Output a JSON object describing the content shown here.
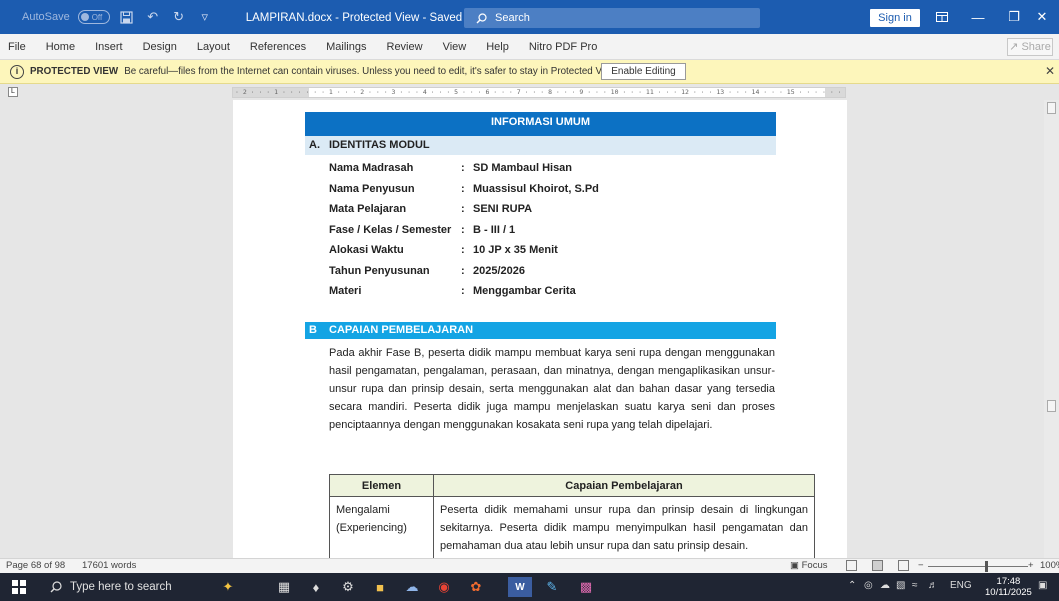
{
  "titlebar": {
    "autosave_label": "AutoSave",
    "autosave_state": "Off",
    "doc_title": "LAMPIRAN.docx  -  Protected View  -  Saved to this PC  ▾",
    "search_placeholder": "Search",
    "sign_in": "Sign in"
  },
  "menu": {
    "items": [
      "File",
      "Home",
      "Insert",
      "Design",
      "Layout",
      "References",
      "Mailings",
      "Review",
      "View",
      "Help",
      "Nitro PDF Pro"
    ],
    "share": "Share"
  },
  "protected_view": {
    "title": "PROTECTED VIEW",
    "message": "Be careful—files from the Internet can contain viruses. Unless you need to edit, it's safer to stay in Protected View.",
    "enable_button": "Enable Editing"
  },
  "ruler": {
    "text": "· 2 · · · 1 · · · · · · 1 · · · 2 · · · 3 · · · 4 · · · 5 · · · 6 · · · 7 · · · 8 · · · 9 · · · 10 · · · 11 · · · 12 · · · 13 · · · 14 · · · 15 · · · · · · 17 · · · 18 ·"
  },
  "document": {
    "header": "INFORMASI UMUM",
    "section_a": {
      "letter": "A.",
      "title": "IDENTITAS MODUL"
    },
    "fields": [
      {
        "label": "Nama Madrasah",
        "value": "SD Mambaul Hisan"
      },
      {
        "label": "Nama Penyusun",
        "value": "Muassisul Khoirot, S.Pd"
      },
      {
        "label": "Mata Pelajaran",
        "value": "SENI RUPA"
      },
      {
        "label": "Fase / Kelas / Semester",
        "value": "B - III / 1"
      },
      {
        "label": "Alokasi Waktu",
        "value": "10 JP x 35 Menit"
      },
      {
        "label": "Tahun Penyusunan",
        "value": "2025/2026"
      },
      {
        "label": "Materi",
        "value": "Menggambar Cerita"
      }
    ],
    "colon": ":",
    "section_b": {
      "letter": "B",
      "title": "CAPAIAN PEMBELAJARAN"
    },
    "paragraph": "Pada akhir Fase B, peserta didik mampu membuat karya seni rupa dengan menggunakan hasil pengamatan, pengalaman, perasaan, dan minatnya, dengan mengaplikasikan unsur-unsur rupa dan prinsip desain, serta menggunakan alat dan bahan dasar yang tersedia secara mandiri. Peserta didik juga mampu menjelaskan suatu karya seni dan proses penciptaannya dengan menggunakan kosakata seni rupa yang telah dipelajari.",
    "table": {
      "headers": [
        "Elemen",
        "Capaian Pembelajaran"
      ],
      "rows": [
        {
          "elemen": "Mengalami (Experiencing)",
          "capaian": "Peserta didik memahami unsur rupa dan prinsip desain di lingkungan sekitarnya. Peserta didik mampu menyimpulkan hasil pengamatan dan pemahaman dua atau lebih unsur rupa dan satu prinsip desain."
        }
      ]
    }
  },
  "statusbar": {
    "page": "Page 68 of 98",
    "words": "17601 words",
    "focus": "Focus",
    "zoom": "100%"
  },
  "taskbar": {
    "search_placeholder": "Type here to search",
    "language": "ENG",
    "time": "17:48",
    "date": "10/11/2025"
  }
}
